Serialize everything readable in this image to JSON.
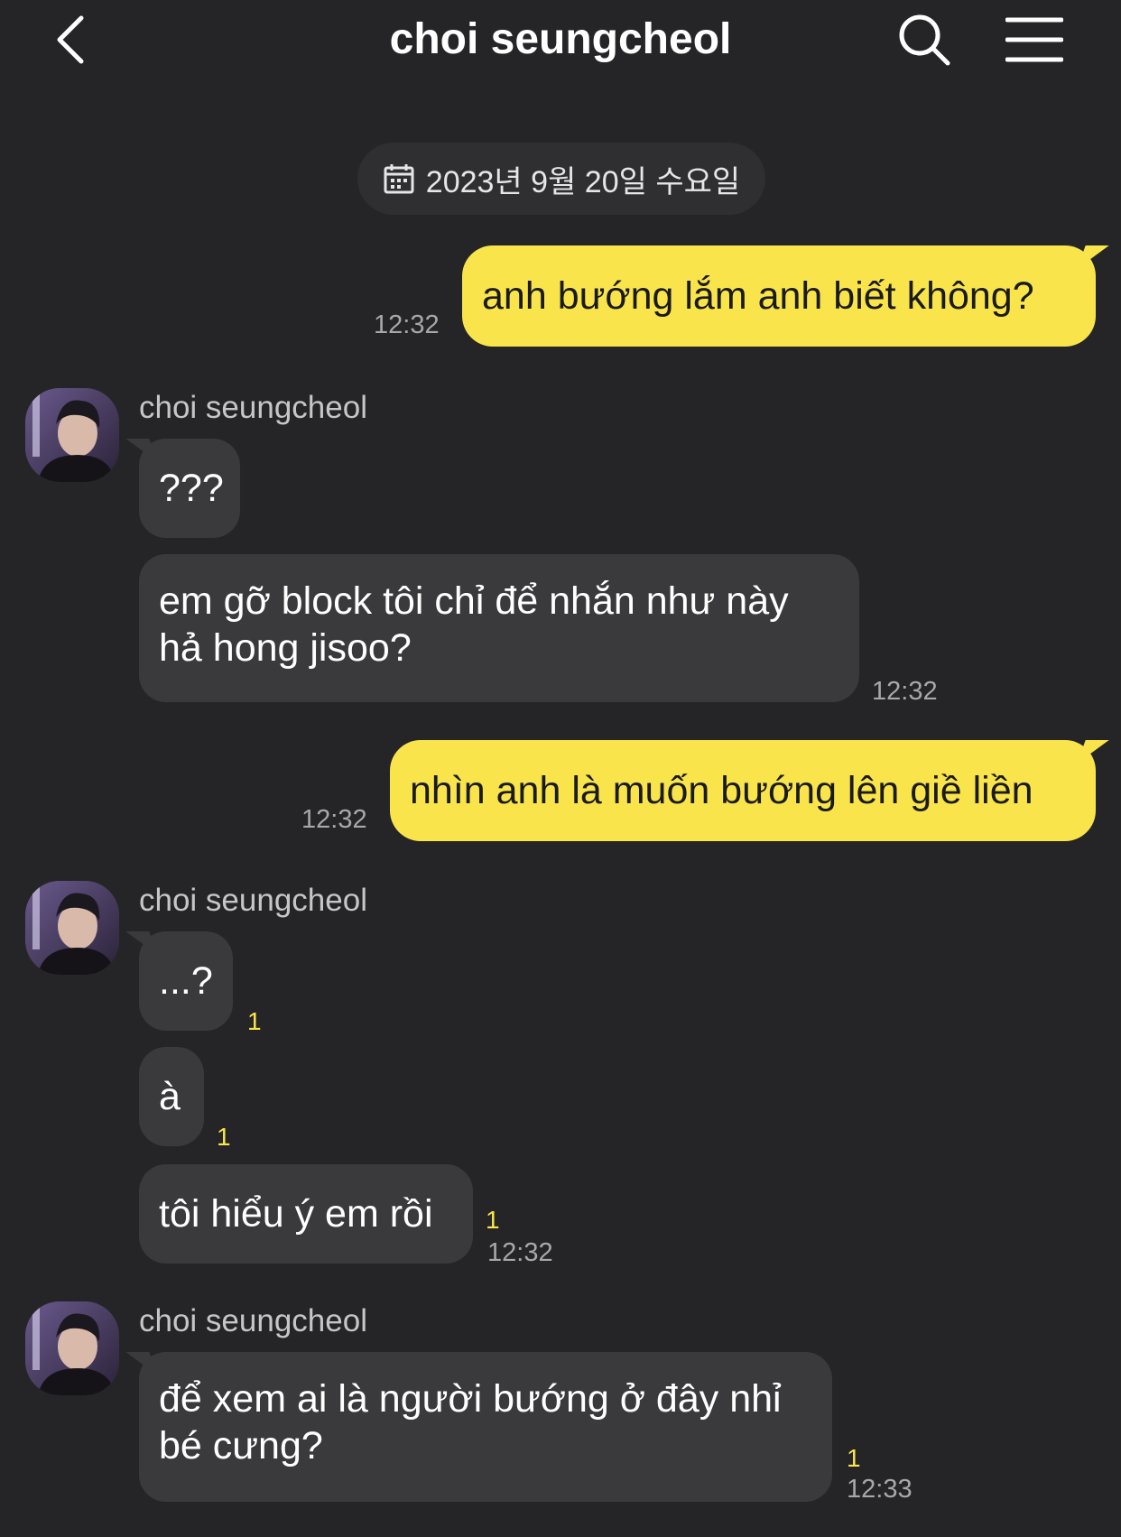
{
  "header": {
    "title": "choi seungcheol",
    "back_icon": "chevron-left-icon",
    "search_icon": "search-icon",
    "menu_icon": "hamburger-menu-icon"
  },
  "date_divider": {
    "label": "2023년 9월 20일 수요일",
    "icon": "calendar-icon"
  },
  "colors": {
    "background": "#252527",
    "sent_bubble": "#f9e54b",
    "received_bubble": "#3a3a3c",
    "unread": "#f9e54b"
  },
  "messages": [
    {
      "side": "sent",
      "text": "anh bướng lắm anh biết không?",
      "time": "12:32"
    },
    {
      "side": "received",
      "sender": "choi seungcheol",
      "text": "???"
    },
    {
      "side": "received",
      "text_line1": "em gỡ block tôi chỉ để nhắn như này",
      "text_line2": "hả hong jisoo?",
      "time": "12:32"
    },
    {
      "side": "sent",
      "text": "nhìn anh là muốn bướng lên giề liền",
      "time": "12:32"
    },
    {
      "side": "received",
      "sender": "choi seungcheol",
      "text": "...?",
      "unread": "1"
    },
    {
      "side": "received",
      "text": "à",
      "unread": "1"
    },
    {
      "side": "received",
      "text": "tôi hiểu ý em rồi",
      "unread": "1",
      "time": "12:32"
    },
    {
      "side": "received",
      "sender": "choi seungcheol",
      "text_line1": "để xem ai là người bướng ở đây nhỉ",
      "text_line2": "bé cưng?",
      "unread": "1",
      "time": "12:33"
    }
  ]
}
